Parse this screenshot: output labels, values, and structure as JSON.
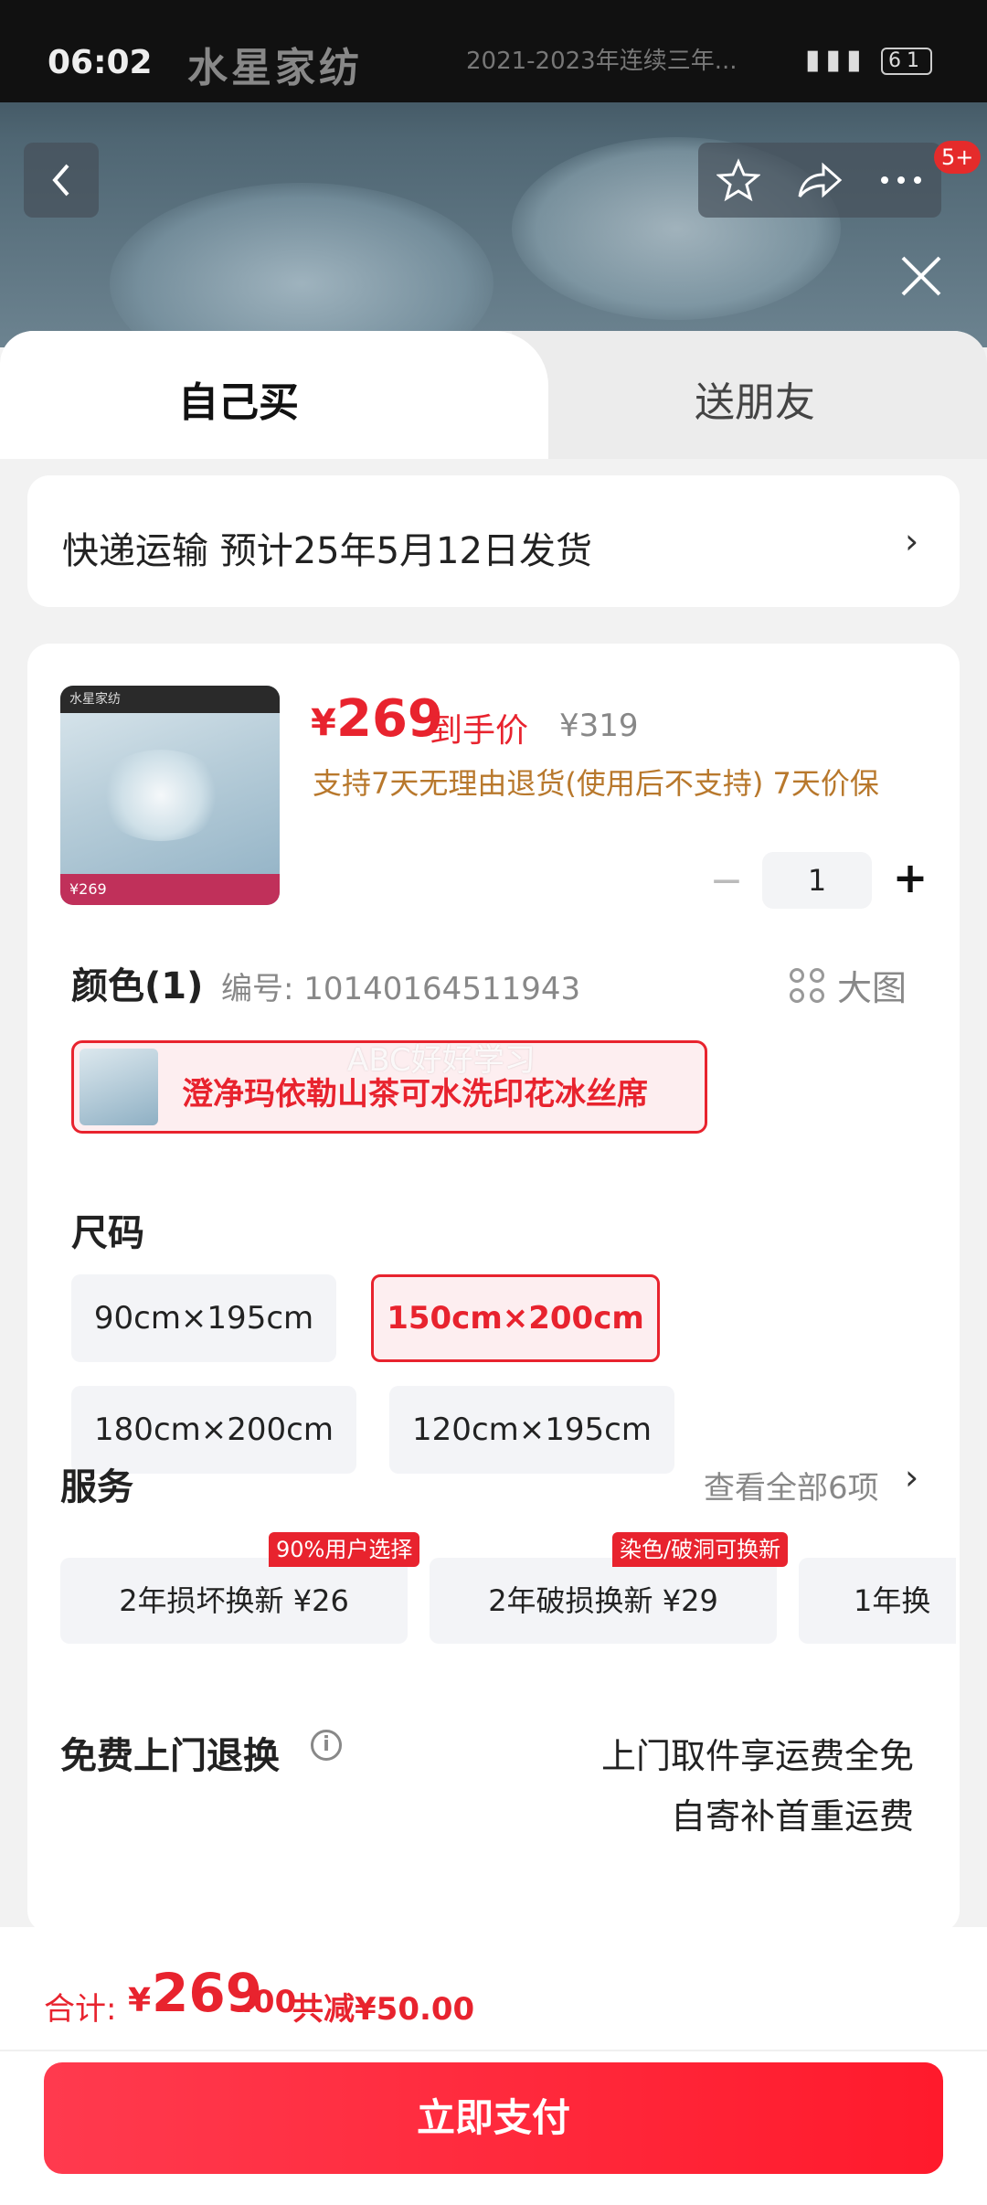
{
  "status_bar": {
    "time": "06:02",
    "brand_overlay": "水星家纺",
    "slogan_overlay": "2021-2023年连续三年... ",
    "battery": "61"
  },
  "top_nav": {
    "notification_badge": "5+"
  },
  "tabs": [
    {
      "label": "自己买",
      "active": true
    },
    {
      "label": "送朋友",
      "active": false
    }
  ],
  "shipping": {
    "text": "快递运输 预计25年5月12日发货"
  },
  "product": {
    "currency": "¥",
    "price": "269",
    "price_label": "到手价",
    "original_price": "¥319",
    "policy": "支持7天无理由退货(使用后不支持) 7天价保",
    "quantity": "1",
    "thumb_brand": "水星家纺",
    "thumb_price": "¥269"
  },
  "color": {
    "title": "颜色(1)",
    "sku": "编号: 10140164511943",
    "big_image_label": "大图",
    "selected_option": "澄净玛依勒山茶可水洗印花冰丝席",
    "watermark": "ABC好好学习"
  },
  "size": {
    "title": "尺码",
    "options": [
      {
        "label": "90cm×195cm",
        "selected": false
      },
      {
        "label": "150cm×200cm",
        "selected": true
      },
      {
        "label": "180cm×200cm",
        "selected": false
      },
      {
        "label": "120cm×195cm",
        "selected": false
      }
    ]
  },
  "services": {
    "title": "服务",
    "view_all": "查看全部6项",
    "items": [
      {
        "label": "2年损坏换新  ¥26",
        "tag": "90%用户选择"
      },
      {
        "label": "2年破损换新  ¥29",
        "tag": "染色/破洞可换新"
      },
      {
        "label": "1年换",
        "tag": ""
      }
    ]
  },
  "free_return": {
    "title": "免费上门退换",
    "line1": "上门取件享运费全免",
    "line2": "自寄补首重运费"
  },
  "footer": {
    "total_label": "合计:",
    "currency": "¥",
    "total_int": "269",
    "total_dec": ".00",
    "savings": "共减¥50.00",
    "pay_button": "立即支付"
  },
  "colors": {
    "accent_red": "#e8232e",
    "policy_gold": "#b8782c"
  }
}
